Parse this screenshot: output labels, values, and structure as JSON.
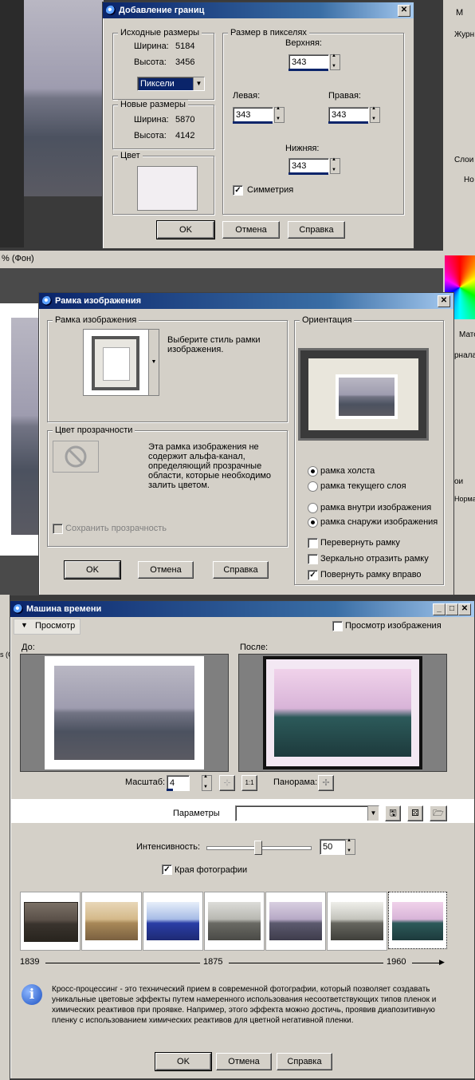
{
  "background": {
    "bg_tab_title": "% (Фон)",
    "right_panel": {
      "item1": "М",
      "item2": "Журн",
      "item3": "Слои",
      "item4": "Но",
      "item5": "Мато",
      "item6": "рнала",
      "item7": "Нормальн",
      "item8": "ои",
      "item9": "Норма"
    },
    "left_strip_label": "s (O"
  },
  "dlg1": {
    "title": "Добавление границ",
    "close": "✕",
    "source_group": "Исходные размеры",
    "width_label": "Ширина:",
    "width_value": "5184",
    "height_label": "Высота:",
    "height_value": "3456",
    "unit_select": "Пиксели",
    "new_group": "Новые размеры",
    "new_width_label": "Ширина:",
    "new_width_value": "5870",
    "new_height_label": "Высота:",
    "new_height_value": "4142",
    "color_group": "Цвет",
    "pixels_group": "Размер в пикселях",
    "top_label": "Верхняя:",
    "top_value": "343",
    "left_label": "Левая:",
    "left_value": "343",
    "right_label": "Правая:",
    "right_value": "343",
    "bottom_label": "Нижняя:",
    "bottom_value": "343",
    "symmetry_label": "Симметрия",
    "symmetry_checked": "✓",
    "ok": "OK",
    "cancel": "Отмена",
    "help": "Справка",
    "color_swatch": "#f2eef2"
  },
  "dlg2": {
    "title": "Рамка изображения",
    "close": "✕",
    "frame_group": "Рамка изображения",
    "frame_desc": "Выберите стиль рамки изображения.",
    "transparency_group": "Цвет прозрачности",
    "transparency_desc": "Эта рамка изображения не содержит альфа-канал, определяющий прозрачные области, которые необходимо залить цветом.",
    "keep_transparency": "Сохранить прозрачность",
    "orientation_group": "Ориентация",
    "opt_canvas": "рамка холста",
    "opt_current_layer": "рамка текущего слоя",
    "opt_inside": "рамка внутри изображения",
    "opt_outside": "рамка снаружи изображения",
    "flip": "Перевернуть рамку",
    "mirror": "Зеркально отразить рамку",
    "rotate": "Повернуть рамку вправо",
    "rotate_checked": "✓",
    "ok": "OK",
    "cancel": "Отмена",
    "help": "Справка"
  },
  "dlg3": {
    "title": "Машина времени",
    "min": "_",
    "max": "□",
    "close": "✕",
    "preview_toggle": "Просмотр",
    "preview_image": "Просмотр изображения",
    "before_label": "До:",
    "after_label": "После:",
    "scale_label": "Масштаб:",
    "scale_value": "4",
    "zoom_11": "1:1",
    "pan_label": "Панорама:",
    "params_label": "Параметры",
    "intensity_label": "Интенсивность:",
    "intensity_value": "50",
    "intensity_level": 0.5,
    "edges_label": "Края фотографии",
    "edges_checked": "✓",
    "timeline": [
      "1839",
      "1875",
      "1960"
    ],
    "info_text": "Кросс-процессинг - это технический прием в современной фотографии, который позволяет создавать уникальные цветовые эффекты путем намеренного использования несоответствующих типов пленок и химических реактивов при проявке. Например, этого эффекта можно достичь, проявив диапозитивную пленку с использованием химических реактивов для цветной негативной пленки.",
    "ok": "OK",
    "cancel": "Отмена",
    "help": "Справка"
  }
}
